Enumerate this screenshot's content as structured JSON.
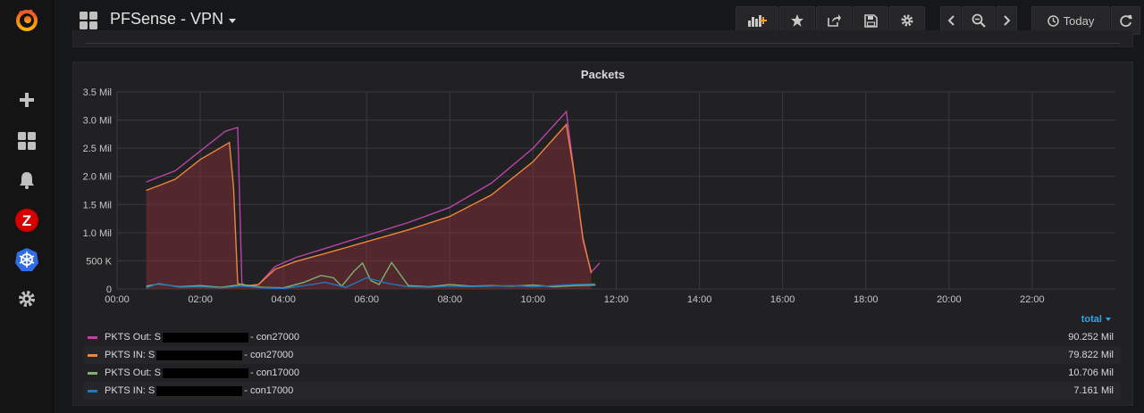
{
  "dashboard": {
    "title": "PFSense - VPN"
  },
  "toolbar": {
    "time_range_label": "Today"
  },
  "sidebar": {
    "items": [
      {
        "icon": "grafana-logo-icon"
      },
      {
        "icon": "plus-icon"
      },
      {
        "icon": "dashboards-icon"
      },
      {
        "icon": "bell-icon"
      },
      {
        "icon": "zabbix-icon",
        "text": "Z"
      },
      {
        "icon": "kubernetes-icon"
      },
      {
        "icon": "gear-icon"
      }
    ]
  },
  "panel": {
    "title": "Packets",
    "legend_sort_label": "total"
  },
  "colors": {
    "purple": "#ba43a9",
    "orange": "#ef843c",
    "green": "#7eb26d",
    "blue": "#1f78c1",
    "accent": "#33a2e5"
  },
  "legend": [
    {
      "prefix": "PKTS Out: S",
      "suffix": "- con27000",
      "total": "90.252 Mil",
      "color": "#ba43a9"
    },
    {
      "prefix": "PKTS IN: S",
      "suffix": "- con27000",
      "total": "79.822 Mil",
      "color": "#ef843c"
    },
    {
      "prefix": "PKTS Out: S",
      "suffix": "- con17000",
      "total": "10.706 Mil",
      "color": "#7eb26d"
    },
    {
      "prefix": "PKTS IN: S",
      "suffix": "- con17000",
      "total": "7.161 Mil",
      "color": "#1f78c1"
    }
  ],
  "chart_data": {
    "type": "line",
    "title": "Packets",
    "xlabel": "",
    "ylabel": "",
    "y_ticks": [
      "0",
      "500 K",
      "1.0 Mil",
      "1.5 Mil",
      "2.0 Mil",
      "2.5 Mil",
      "3.0 Mil",
      "3.5 Mil"
    ],
    "x_ticks": [
      "00:00",
      "02:00",
      "04:00",
      "06:00",
      "08:00",
      "10:00",
      "12:00",
      "14:00",
      "16:00",
      "18:00",
      "20:00",
      "22:00"
    ],
    "ylim": [
      0,
      3500000
    ],
    "xlim_hours": [
      0,
      24
    ],
    "grid": true,
    "series": [
      {
        "name": "PKTS Out - con27000",
        "color": "#ba43a9",
        "fill": false,
        "x": [
          0.7,
          1.4,
          2.0,
          2.6,
          2.9,
          3.0,
          3.1,
          3.4,
          3.8,
          4.3,
          5.0,
          6.0,
          7.0,
          8.0,
          9.0,
          10.0,
          10.8,
          11.2,
          11.4,
          11.6
        ],
        "y": [
          1900000,
          2100000,
          2450000,
          2800000,
          2870000,
          100000,
          60000,
          80000,
          400000,
          560000,
          720000,
          950000,
          1180000,
          1450000,
          1880000,
          2500000,
          3150000,
          850000,
          300000,
          460000
        ]
      },
      {
        "name": "PKTS IN - con27000",
        "color": "#ef843c",
        "fill": true,
        "x": [
          0.7,
          1.4,
          2.0,
          2.7,
          2.8,
          2.9,
          3.1,
          3.4,
          3.8,
          4.3,
          5.0,
          6.0,
          7.0,
          8.0,
          9.0,
          10.0,
          10.8,
          11.0,
          11.2,
          11.4
        ],
        "y": [
          1750000,
          1950000,
          2300000,
          2600000,
          1800000,
          100000,
          50000,
          80000,
          350000,
          490000,
          630000,
          840000,
          1050000,
          1290000,
          1670000,
          2260000,
          2920000,
          2000000,
          900000,
          280000
        ]
      },
      {
        "name": "PKTS Out - con17000",
        "color": "#7eb26d",
        "fill": false,
        "x": [
          0.7,
          1.0,
          1.5,
          2.0,
          2.5,
          3.0,
          3.5,
          4.0,
          4.5,
          4.9,
          5.2,
          5.4,
          5.7,
          5.9,
          6.1,
          6.3,
          6.6,
          7.0,
          7.5,
          8.0,
          8.5,
          9.0,
          9.5,
          10.0,
          10.5,
          11.0,
          11.5
        ],
        "y": [
          50000,
          90000,
          40000,
          60000,
          30000,
          80000,
          30000,
          20000,
          120000,
          240000,
          200000,
          50000,
          320000,
          460000,
          150000,
          80000,
          470000,
          60000,
          40000,
          80000,
          50000,
          60000,
          50000,
          70000,
          40000,
          60000,
          70000
        ]
      },
      {
        "name": "PKTS IN - con17000",
        "color": "#1f78c1",
        "fill": false,
        "x": [
          0.7,
          1.0,
          1.5,
          2.0,
          2.5,
          3.0,
          3.5,
          4.0,
          4.5,
          5.0,
          5.5,
          6.0,
          6.5,
          7.0,
          7.5,
          8.0,
          8.5,
          9.0,
          9.5,
          10.0,
          10.5,
          11.0,
          11.5
        ],
        "y": [
          20000,
          100000,
          30000,
          40000,
          20000,
          50000,
          20000,
          10000,
          60000,
          120000,
          30000,
          200000,
          100000,
          40000,
          30000,
          50000,
          40000,
          50000,
          60000,
          40000,
          60000,
          80000,
          90000
        ]
      }
    ]
  }
}
